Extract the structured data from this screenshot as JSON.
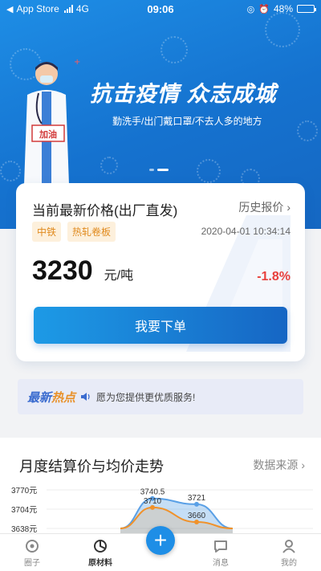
{
  "status_bar": {
    "carrier": "App Store",
    "network": "4G",
    "time": "09:06",
    "battery": "48%",
    "battery_level": 0.48
  },
  "banner": {
    "title": "抗击疫情  众志成城",
    "subtitle": "勤洗手/出门戴口罩/不去人多的地方",
    "sign_text": "加油"
  },
  "price_card": {
    "title": "当前最新价格(出厂直发)",
    "history_label": "历史报价",
    "tags": [
      "中铁",
      "热轧卷板"
    ],
    "timestamp": "2020-04-01 10:34:14",
    "price": "3230",
    "unit": "元/吨",
    "change": "-1.8%",
    "order_button": "我要下单"
  },
  "hot_news": {
    "label_part1": "最新",
    "label_part2": "热点",
    "message": "愿为您提供更优质服务!"
  },
  "trend": {
    "title": "月度结算价与均价走势",
    "source_link": "数据来源"
  },
  "chart_data": {
    "type": "area",
    "y_tick_labels": [
      "3770元",
      "3704元",
      "3638元"
    ],
    "ylim": [
      3638,
      3770
    ],
    "series": [
      {
        "values": [
          3638,
          3740.5,
          3721,
          3638
        ],
        "point_labels": [
          "",
          "3740.5",
          "3721",
          ""
        ]
      },
      {
        "values": [
          3638,
          3710,
          3660,
          3638
        ],
        "point_labels": [
          "",
          "3710",
          "3660",
          ""
        ]
      }
    ],
    "colors": [
      "#5aa0e6",
      "#f0922b"
    ]
  },
  "tabbar": {
    "items": [
      {
        "label": "圈子",
        "icon": "circle-icon"
      },
      {
        "label": "原材料",
        "icon": "chart-pie-icon"
      },
      {
        "label": "消息",
        "icon": "message-icon"
      },
      {
        "label": "我的",
        "icon": "person-icon"
      }
    ],
    "fab": "+"
  },
  "colors": {
    "brand_blue": "#1e8ee6",
    "tag_orange": "#e08a1e",
    "change_red": "#e8403c"
  }
}
